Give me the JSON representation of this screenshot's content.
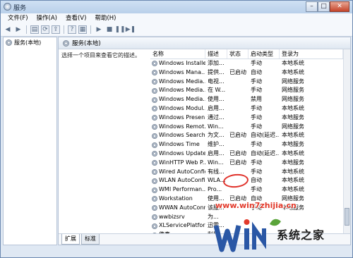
{
  "window": {
    "title": "服务",
    "controls": [
      "–",
      "□",
      "✕"
    ]
  },
  "menu": [
    "文件(F)",
    "操作(A)",
    "查看(V)",
    "帮助(H)"
  ],
  "toolbar": [
    "back-icon",
    "forward-icon",
    "console-tree-icon",
    "refresh-icon",
    "export-icon",
    "help-icon",
    "properties-icon",
    "play-icon",
    "stop-icon",
    "pause-icon",
    "restart-icon"
  ],
  "tree": {
    "label": "服务(本地)"
  },
  "pane": {
    "title": "服务(本地)",
    "description_hint": "选择一个项目来查看它的描述。"
  },
  "table": {
    "headers": [
      "名称",
      "描述",
      "状态",
      "启动类型",
      "登录为"
    ],
    "rows": [
      [
        "Windows Installer",
        "添加...",
        "",
        "手动",
        "本地系统"
      ],
      [
        "Windows Mana...",
        "提供...",
        "已启动",
        "自动",
        "本地系统"
      ],
      [
        "Windows Media...",
        "电视...",
        "",
        "手动",
        "网络服务"
      ],
      [
        "Windows Media...",
        "在 W...",
        "",
        "手动",
        "网络服务"
      ],
      [
        "Windows Media...",
        "使用...",
        "",
        "禁用",
        "网络服务"
      ],
      [
        "Windows Modul...",
        "启用...",
        "",
        "手动",
        "本地系统"
      ],
      [
        "Windows Presen...",
        "通过...",
        "",
        "手动",
        "本地服务"
      ],
      [
        "Windows Remot...",
        "Win...",
        "",
        "手动",
        "网络服务"
      ],
      [
        "Windows Search",
        "为文...",
        "已启动",
        "自动(延迟...",
        "本地系统"
      ],
      [
        "Windows Time",
        "维护...",
        "",
        "手动",
        "本地服务"
      ],
      [
        "Windows Update",
        "启用...",
        "已启动",
        "自动(延迟...",
        "本地系统"
      ],
      [
        "WinHTTP Web P...",
        "Win...",
        "已启动",
        "手动",
        "本地服务"
      ],
      [
        "Wired AutoConfig",
        "有线...",
        "",
        "手动",
        "本地系统"
      ],
      [
        "WLAN AutoConfig",
        "WLA...",
        "",
        "自动",
        "本地系统"
      ],
      [
        "WMI Performan...",
        "Pro...",
        "",
        "手动",
        "本地系统"
      ],
      [
        "Workstation",
        "使用...",
        "已启动",
        "自动",
        "网络服务"
      ],
      [
        "WWAN AutoConn...",
        "该服...",
        "",
        "手动",
        "本地服务"
      ],
      [
        "wwbizsrv",
        "为...",
        "",
        "",
        ""
      ],
      [
        "XLServicePlatform",
        "迅雷...",
        "",
        "",
        ""
      ],
      [
        "传真",
        "利用...",
        "",
        "",
        ""
      ]
    ]
  },
  "tabs": [
    "扩展",
    "标准"
  ],
  "watermark": {
    "url": "www.win7zhijia.cn",
    "brand": "系统之家"
  }
}
